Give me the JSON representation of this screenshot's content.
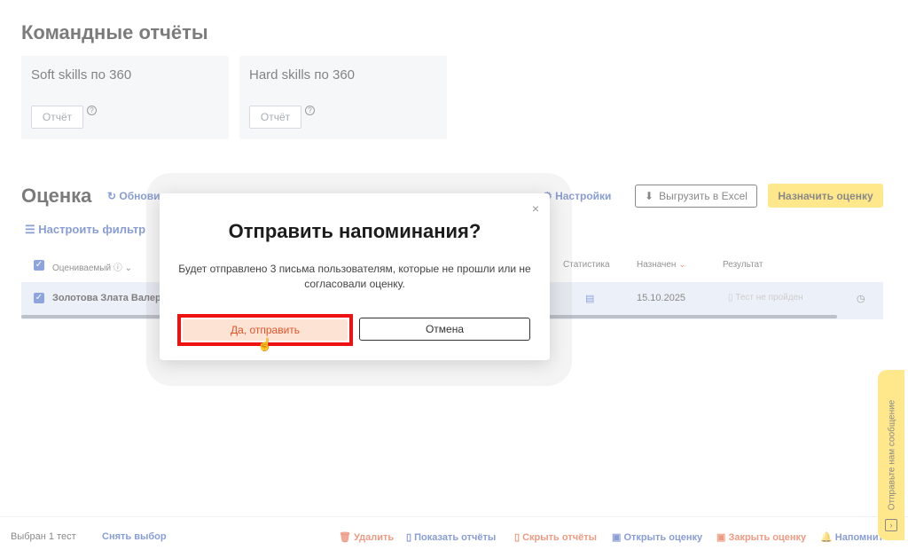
{
  "team_reports": {
    "title": "Командные отчёты",
    "cards": [
      {
        "title": "Soft skills по 360",
        "button": "Отчёт",
        "help": "?"
      },
      {
        "title": "Hard skills по 360",
        "button": "Отчёт",
        "help": "?"
      }
    ]
  },
  "evaluation": {
    "title": "Оценка",
    "refresh": "Обнови",
    "settings": "Настройки",
    "export_button": "Выгрузить в Excel",
    "assign_button": "Назначить оценку",
    "filter": "Настроить фильтр"
  },
  "table": {
    "headers": {
      "evaluated": "Оцениваемый",
      "statistics": "Статистика",
      "assigned": "Назначен",
      "result": "Результат"
    },
    "rows": [
      {
        "name": "Золотова Злата Валерь",
        "assigned": "15.10.2025",
        "result": "Тест не пройден"
      }
    ]
  },
  "footer": {
    "selected_label": "Выбран",
    "selected_count": "1",
    "selected_unit": "тест",
    "clear": "Снять выбор",
    "actions": {
      "delete": "Удалить",
      "show_reports": "Показать отчёты",
      "hide_reports": "Скрыть отчёты",
      "open_eval": "Открыть оценку",
      "close_eval": "Закрыть оценку",
      "remind": "Напомнит"
    }
  },
  "chat_tab": {
    "label": "Отправьте нам сообщение"
  },
  "modal": {
    "title": "Отправить напоминания?",
    "text": "Будет отправлено 3 письма пользователям, которые не прошли или не согласовали оценку.",
    "confirm": "Да, отправить",
    "cancel": "Отмена",
    "close": "×"
  },
  "colors": {
    "accent_blue": "#3557b7",
    "accent_yellow": "#ffd83a",
    "danger_orange": "#e0542a",
    "highlight_red": "#ee1111"
  }
}
